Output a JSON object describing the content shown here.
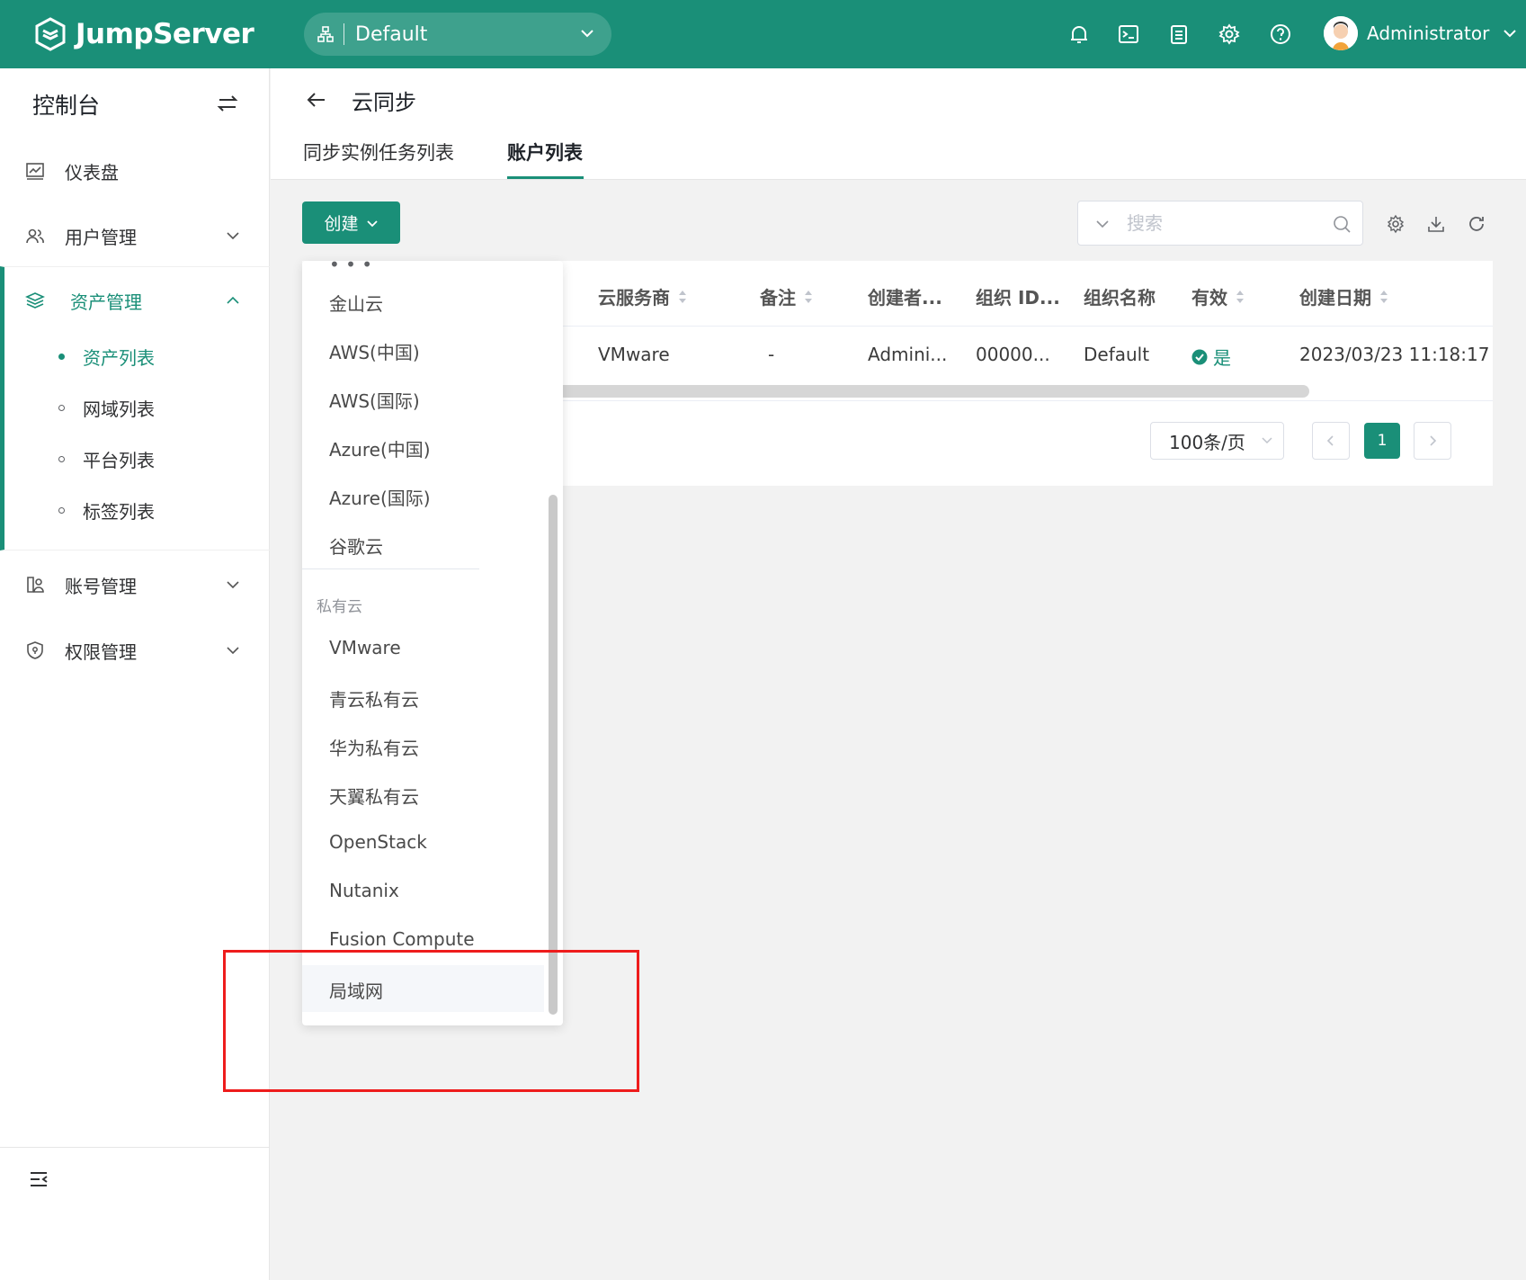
{
  "app": {
    "name": "JumpServer"
  },
  "header": {
    "org": "Default",
    "icons": [
      "bell-icon",
      "terminal-icon",
      "clipboard-icon",
      "gear-icon",
      "help-icon"
    ],
    "user": "Administrator"
  },
  "sidebar": {
    "title": "控制台",
    "items": [
      {
        "label": "仪表盘",
        "icon": "dashboard-icon"
      },
      {
        "label": "用户管理",
        "icon": "users-icon"
      },
      {
        "label": "资产管理",
        "icon": "layers-icon",
        "active": true
      },
      {
        "label": "账号管理",
        "icon": "account-icon"
      },
      {
        "label": "权限管理",
        "icon": "shield-icon"
      }
    ],
    "subitems": [
      {
        "label": "资产列表",
        "active": true
      },
      {
        "label": "网域列表"
      },
      {
        "label": "平台列表"
      },
      {
        "label": "标签列表"
      }
    ]
  },
  "main": {
    "title": "云同步",
    "tabs": [
      {
        "label": "同步实例任务列表"
      },
      {
        "label": "账户列表",
        "active": true
      }
    ],
    "create_label": "创建",
    "search_placeholder": "搜索",
    "table": {
      "headers": [
        "云服务商",
        "备注",
        "创建者...",
        "组织 ID...",
        "组织名称",
        "有效",
        "创建日期"
      ],
      "rows": [
        [
          "VMware",
          "-",
          "Admini...",
          "00000...",
          "Default",
          "是",
          "2023/03/23 11:18:17"
        ]
      ]
    },
    "pagination": {
      "page_size": "100条/页",
      "current": "1"
    }
  },
  "dropdown": {
    "public": [
      "金山云",
      "AWS(中国)",
      "AWS(国际)",
      "Azure(中国)",
      "Azure(国际)",
      "谷歌云"
    ],
    "private_group": "私有云",
    "private": [
      "VMware",
      "青云私有云",
      "华为私有云",
      "天翼私有云",
      "OpenStack",
      "Nutanix",
      "Fusion Compute",
      "局域网"
    ]
  },
  "colors": {
    "brand": "#1a8f78",
    "highlight": "#ee1c1c"
  }
}
